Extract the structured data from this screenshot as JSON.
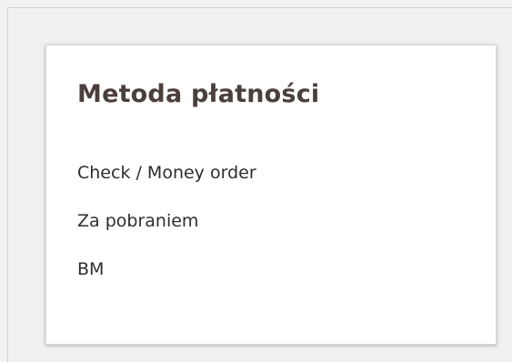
{
  "payment_section": {
    "title": "Metoda płatności",
    "methods": [
      {
        "label": "Check / Money order"
      },
      {
        "label": "Za pobraniem"
      },
      {
        "label": "BM"
      }
    ]
  },
  "colors": {
    "background": "#f1f1f1",
    "card": "#ffffff",
    "title": "#4a3f3a",
    "text": "#2d2d2d"
  }
}
